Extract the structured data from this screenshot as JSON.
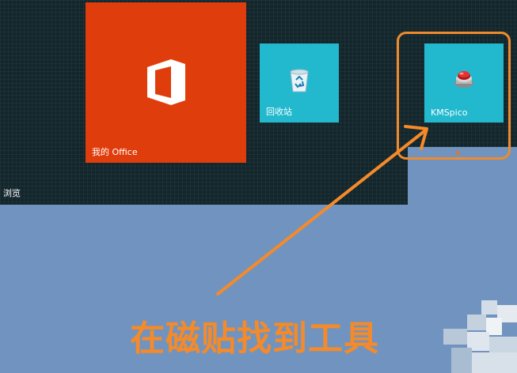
{
  "tiles": {
    "office": {
      "label": "我的 Office",
      "icon": "office-logo-icon",
      "color": "#e03d0c"
    },
    "recycle": {
      "label": "回收站",
      "icon": "recycle-bin-icon",
      "color": "#22b8ce"
    },
    "kms": {
      "label": "KMSpico",
      "icon": "kmspico-red-button-icon",
      "color": "#22b8ce"
    }
  },
  "section": {
    "label": "浏览"
  },
  "annotation": {
    "caption": "在磁贴找到工具",
    "color": "#f58a2a"
  }
}
